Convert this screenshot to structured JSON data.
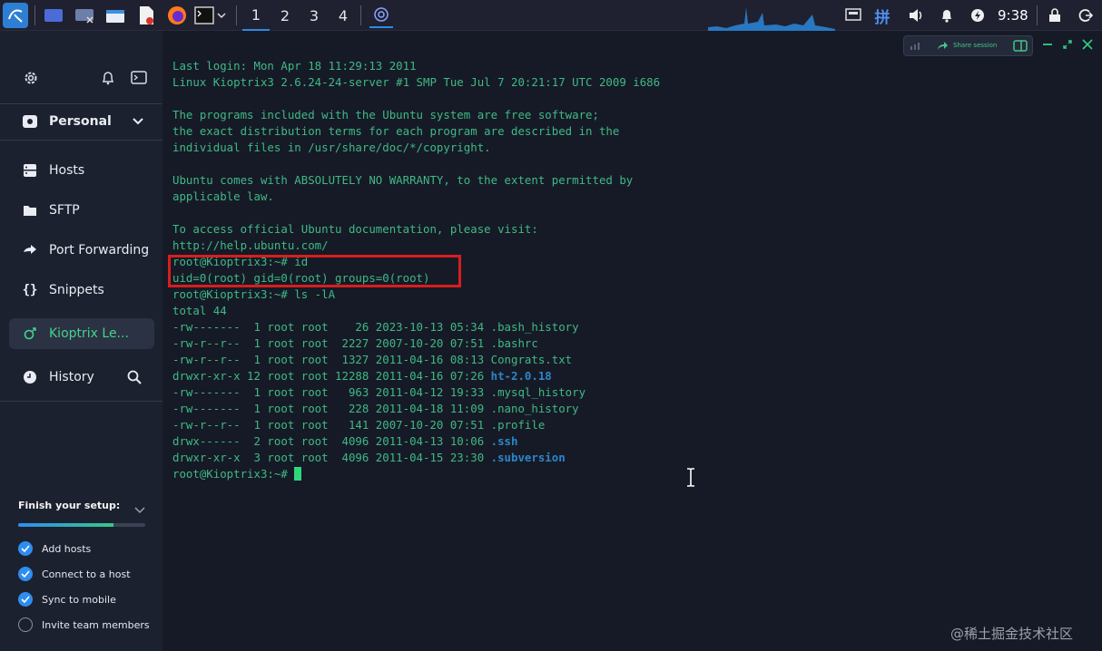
{
  "taskbar": {
    "workspaces": [
      "1",
      "2",
      "3",
      "4"
    ],
    "active_workspace": "1",
    "input_method": "拼",
    "clock": "9:38"
  },
  "sidebar": {
    "vault": "Personal",
    "nav": [
      {
        "label": "Hosts",
        "icon": "hosts-icon"
      },
      {
        "label": "SFTP",
        "icon": "folder-icon"
      },
      {
        "label": "Port Forwarding",
        "icon": "arrow-icon"
      },
      {
        "label": "Snippets",
        "icon": "braces-icon"
      }
    ],
    "active_host": "Kioptrix Le...",
    "history": "History",
    "setup": {
      "title": "Finish your setup:",
      "progress": 0.75,
      "items": [
        {
          "label": "Add hosts",
          "done": true
        },
        {
          "label": "Connect to a host",
          "done": true
        },
        {
          "label": "Sync to mobile",
          "done": true
        },
        {
          "label": "Invite team members",
          "done": false
        }
      ]
    }
  },
  "terminal": {
    "share_label": "Share session",
    "lines_top": [
      "Last login: Mon Apr 18 11:29:13 2011",
      "Linux Kioptrix3 2.6.24-24-server #1 SMP Tue Jul 7 20:21:17 UTC 2009 i686",
      "",
      "The programs included with the Ubuntu system are free software;",
      "the exact distribution terms for each program are described in the",
      "individual files in /usr/share/doc/*/copyright.",
      "",
      "Ubuntu comes with ABSOLUTELY NO WARRANTY, to the extent permitted by",
      "applicable law.",
      "",
      "To access official Ubuntu documentation, please visit:",
      "http://help.ubuntu.com/",
      "root@Kioptrix3:~# id",
      "uid=0(root) gid=0(root) groups=0(root)",
      "root@Kioptrix3:~# ls -lA",
      "total 44"
    ],
    "listing": [
      {
        "prefix": "-rw-------  1 root root    26 2023-10-13 05:34 ",
        "name": ".bash_history",
        "dir": false
      },
      {
        "prefix": "-rw-r--r--  1 root root  2227 2007-10-20 07:51 ",
        "name": ".bashrc",
        "dir": false
      },
      {
        "prefix": "-rw-r--r--  1 root root  1327 2011-04-16 08:13 ",
        "name": "Congrats.txt",
        "dir": false
      },
      {
        "prefix": "drwxr-xr-x 12 root root 12288 2011-04-16 07:26 ",
        "name": "ht-2.0.18",
        "dir": true
      },
      {
        "prefix": "-rw-------  1 root root   963 2011-04-12 19:33 ",
        "name": ".mysql_history",
        "dir": false
      },
      {
        "prefix": "-rw-------  1 root root   228 2011-04-18 11:09 ",
        "name": ".nano_history",
        "dir": false
      },
      {
        "prefix": "-rw-r--r--  1 root root   141 2007-10-20 07:51 ",
        "name": ".profile",
        "dir": false
      },
      {
        "prefix": "drwx------  2 root root  4096 2011-04-13 10:06 ",
        "name": ".ssh",
        "dir": true
      },
      {
        "prefix": "drwxr-xr-x  3 root root  4096 2011-04-15 23:30 ",
        "name": ".subversion",
        "dir": true
      }
    ],
    "prompt": "root@Kioptrix3:~# "
  },
  "watermark": "@稀土掘金技术社区",
  "colors": {
    "terminal_text": "#3fb986",
    "directory": "#2b86c9",
    "highlight_box": "#d81e1e",
    "accent": "#2f8df0"
  }
}
